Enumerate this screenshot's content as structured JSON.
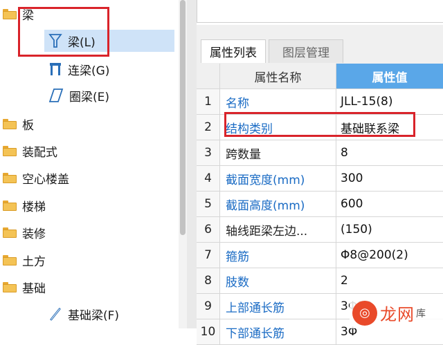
{
  "tree": {
    "items": [
      {
        "label": "梁",
        "icon": "folder-open-icon"
      },
      {
        "label": "梁(L)",
        "icon": "beam-icon"
      },
      {
        "label": "连梁(G)",
        "icon": "coupling-beam-icon"
      },
      {
        "label": "圈梁(E)",
        "icon": "ring-beam-icon"
      },
      {
        "label": "板",
        "icon": "folder-icon"
      },
      {
        "label": "装配式",
        "icon": "folder-icon"
      },
      {
        "label": "空心楼盖",
        "icon": "folder-icon"
      },
      {
        "label": "楼梯",
        "icon": "folder-icon"
      },
      {
        "label": "装修",
        "icon": "folder-icon"
      },
      {
        "label": "土方",
        "icon": "folder-icon"
      },
      {
        "label": "基础",
        "icon": "folder-open-icon"
      },
      {
        "label": "基础梁(F)",
        "icon": "foundation-beam-icon"
      }
    ]
  },
  "panel": {
    "tabs": [
      "属性列表",
      "图层管理"
    ],
    "active_tab": 0,
    "columns": [
      "属性名称",
      "属性值"
    ],
    "rows": [
      {
        "num": "1",
        "name": "名称",
        "value": "JLL-15(8)",
        "link": true
      },
      {
        "num": "2",
        "name": "结构类别",
        "value": "基础联系梁",
        "link": true
      },
      {
        "num": "3",
        "name": "跨数量",
        "value": "8",
        "link": false
      },
      {
        "num": "4",
        "name": "截面宽度(mm)",
        "value": "300",
        "link": true
      },
      {
        "num": "5",
        "name": "截面高度(mm)",
        "value": "600",
        "link": true
      },
      {
        "num": "6",
        "name": "轴线距梁左边...",
        "value": "(150)",
        "link": false
      },
      {
        "num": "7",
        "name": "箍筋",
        "value": "Φ8@200(2)",
        "link": true
      },
      {
        "num": "8",
        "name": "肢数",
        "value": "2",
        "link": true
      },
      {
        "num": "9",
        "name": "上部通长筋",
        "value": "3Φ18",
        "link": true
      },
      {
        "num": "10",
        "name": "下部通长筋",
        "value": "3Φ",
        "link": true
      }
    ]
  },
  "watermark": {
    "text": "龙网",
    "suffix": "库"
  },
  "colors": {
    "accent": "#5aa7e8",
    "highlight": "#d9232a",
    "link": "#1a6bc4",
    "selection": "#cfe3f8"
  }
}
